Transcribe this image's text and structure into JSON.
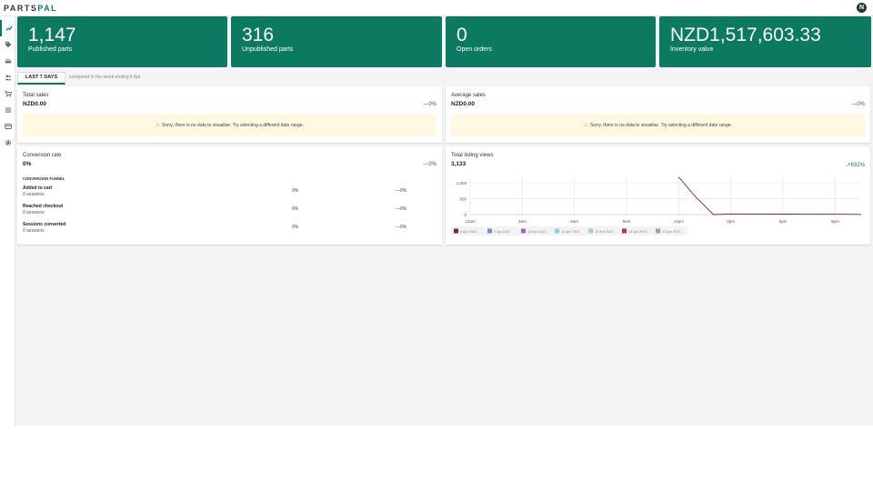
{
  "app": {
    "logo_part1": "PARTS",
    "logo_part2": "PAL",
    "avatar_initial": "N"
  },
  "sidebar": {
    "items": [
      {
        "icon": "trend-icon",
        "active": true
      },
      {
        "icon": "tag-icon"
      },
      {
        "icon": "car-icon"
      },
      {
        "icon": "users-icon"
      },
      {
        "icon": "cart-icon"
      },
      {
        "icon": "list-icon"
      },
      {
        "icon": "card-icon"
      },
      {
        "icon": "gear-icon"
      }
    ]
  },
  "stats": [
    {
      "value": "1,147",
      "label": "Published parts"
    },
    {
      "value": "316",
      "label": "Unpublished parts"
    },
    {
      "value": "0",
      "label": "Open orders"
    },
    {
      "value": "NZD1,517,603.33",
      "label": "Inventory value"
    }
  ],
  "range": {
    "tab_label": "LAST 7 DAYS",
    "note": "compared to the week ending 8 Apr"
  },
  "total_sales": {
    "title": "Total sales",
    "value": "NZD0.00",
    "change": "—0%",
    "nodata": "Sorry, there is no data to visualise. Try selecting a different date range."
  },
  "average_sales": {
    "title": "Average sales",
    "value": "NZD0.00",
    "change": "—0%",
    "nodata": "Sorry, there is no data to visualise. Try selecting a different date range."
  },
  "conversion": {
    "title": "Conversion rate",
    "value": "0%",
    "change": "—0%",
    "funnel_heading": "CONVERSION FUNNEL",
    "rows": [
      {
        "name": "Added to cart",
        "sub": "0 sessions",
        "pct": "0%",
        "change": "—0%"
      },
      {
        "name": "Reached checkout",
        "sub": "0 sessions",
        "pct": "0%",
        "change": "—0%"
      },
      {
        "name": "Sessions converted",
        "sub": "0 sessions",
        "pct": "0%",
        "change": "—0%"
      }
    ]
  },
  "listing_views": {
    "title": "Total listing views",
    "value": "3,133",
    "change": "↗632%"
  },
  "colors": {
    "brand": "#0b7a61",
    "warning_bg": "#fff8e3",
    "series_line": "#8b2335"
  },
  "chart_data": {
    "type": "line",
    "x": [
      "12am",
      "3am",
      "6am",
      "9am",
      "12pm",
      "3pm",
      "6pm",
      "9pm"
    ],
    "x_hours": [
      0,
      3,
      6,
      9,
      12,
      15,
      18,
      21
    ],
    "xlim": [
      0,
      22.5
    ],
    "ylim": [
      0,
      1000
    ],
    "yticks": [
      0,
      500,
      1000
    ],
    "ytick_labels": [
      "0",
      "500",
      "1,000"
    ],
    "grid": true,
    "legend_position": "bottom-left",
    "series": [
      {
        "name": "8 Apr 2020",
        "color": "#8b2335",
        "points": [
          [
            12,
            1180
          ],
          [
            13,
            540
          ],
          [
            14,
            0
          ],
          [
            15,
            20
          ],
          [
            18,
            15
          ],
          [
            21,
            10
          ],
          [
            22.5,
            5
          ]
        ]
      },
      {
        "name": "9 Apr 2020",
        "color": "#6d8fd6",
        "points": []
      },
      {
        "name": "10 Apr 2020",
        "color": "#9b6fa8",
        "points": []
      },
      {
        "name": "11 Apr 2020",
        "color": "#8fd0e8",
        "points": []
      },
      {
        "name": "12 Apr 2020",
        "color": "#a8c8e8",
        "points": []
      },
      {
        "name": "13 Apr 2020",
        "color": "#a83a4a",
        "points": []
      },
      {
        "name": "14 Apr 2020",
        "color": "#7fb88a",
        "points": []
      }
    ]
  }
}
